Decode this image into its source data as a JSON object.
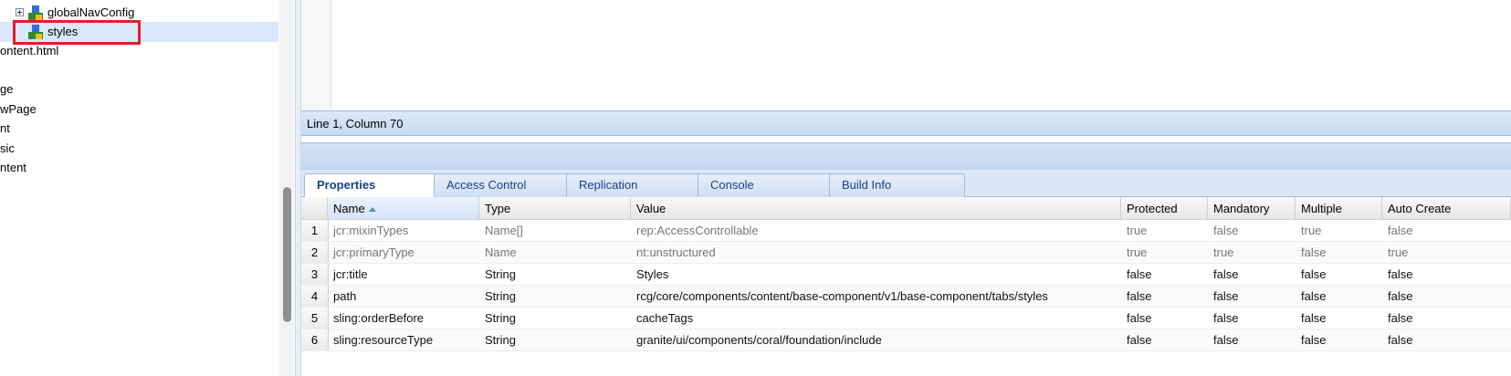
{
  "tree": {
    "items": [
      {
        "label": "globalNavConfig"
      },
      {
        "label": "styles"
      },
      {
        "label": "ontent.html"
      },
      {
        "label": "ge"
      },
      {
        "label": "wPage"
      },
      {
        "label": "nt"
      },
      {
        "label": "sic"
      },
      {
        "label": "ntent"
      }
    ]
  },
  "editor": {
    "status": "Line 1, Column 70"
  },
  "tabs": [
    {
      "label": "Properties"
    },
    {
      "label": "Access Control"
    },
    {
      "label": "Replication"
    },
    {
      "label": "Console"
    },
    {
      "label": "Build Info"
    }
  ],
  "grid": {
    "columns": [
      "Name",
      "Type",
      "Value",
      "Protected",
      "Mandatory",
      "Multiple",
      "Auto Create"
    ],
    "rows": [
      {
        "num": "1",
        "name": "jcr:mixinTypes",
        "type": "Name[]",
        "value": "rep:AccessControllable",
        "protected": "true",
        "mandatory": "false",
        "multiple": "true",
        "auto": "false"
      },
      {
        "num": "2",
        "name": "jcr:primaryType",
        "type": "Name",
        "value": "nt:unstructured",
        "protected": "true",
        "mandatory": "true",
        "multiple": "false",
        "auto": "true"
      },
      {
        "num": "3",
        "name": "jcr:title",
        "type": "String",
        "value": "Styles",
        "protected": "false",
        "mandatory": "false",
        "multiple": "false",
        "auto": "false"
      },
      {
        "num": "4",
        "name": "path",
        "type": "String",
        "value": "rcg/core/components/content/base-component/v1/base-component/tabs/styles",
        "protected": "false",
        "mandatory": "false",
        "multiple": "false",
        "auto": "false"
      },
      {
        "num": "5",
        "name": "sling:orderBefore",
        "type": "String",
        "value": "cacheTags",
        "protected": "false",
        "mandatory": "false",
        "multiple": "false",
        "auto": "false"
      },
      {
        "num": "6",
        "name": "sling:resourceType",
        "type": "String",
        "value": "granite/ui/components/coral/foundation/include",
        "protected": "false",
        "mandatory": "false",
        "multiple": "false",
        "auto": "false"
      }
    ]
  },
  "colors": {
    "selection": "#d9e8fb",
    "highlight": "#e0202a",
    "tab_text": "#15428b",
    "border": "#99bbe8"
  }
}
